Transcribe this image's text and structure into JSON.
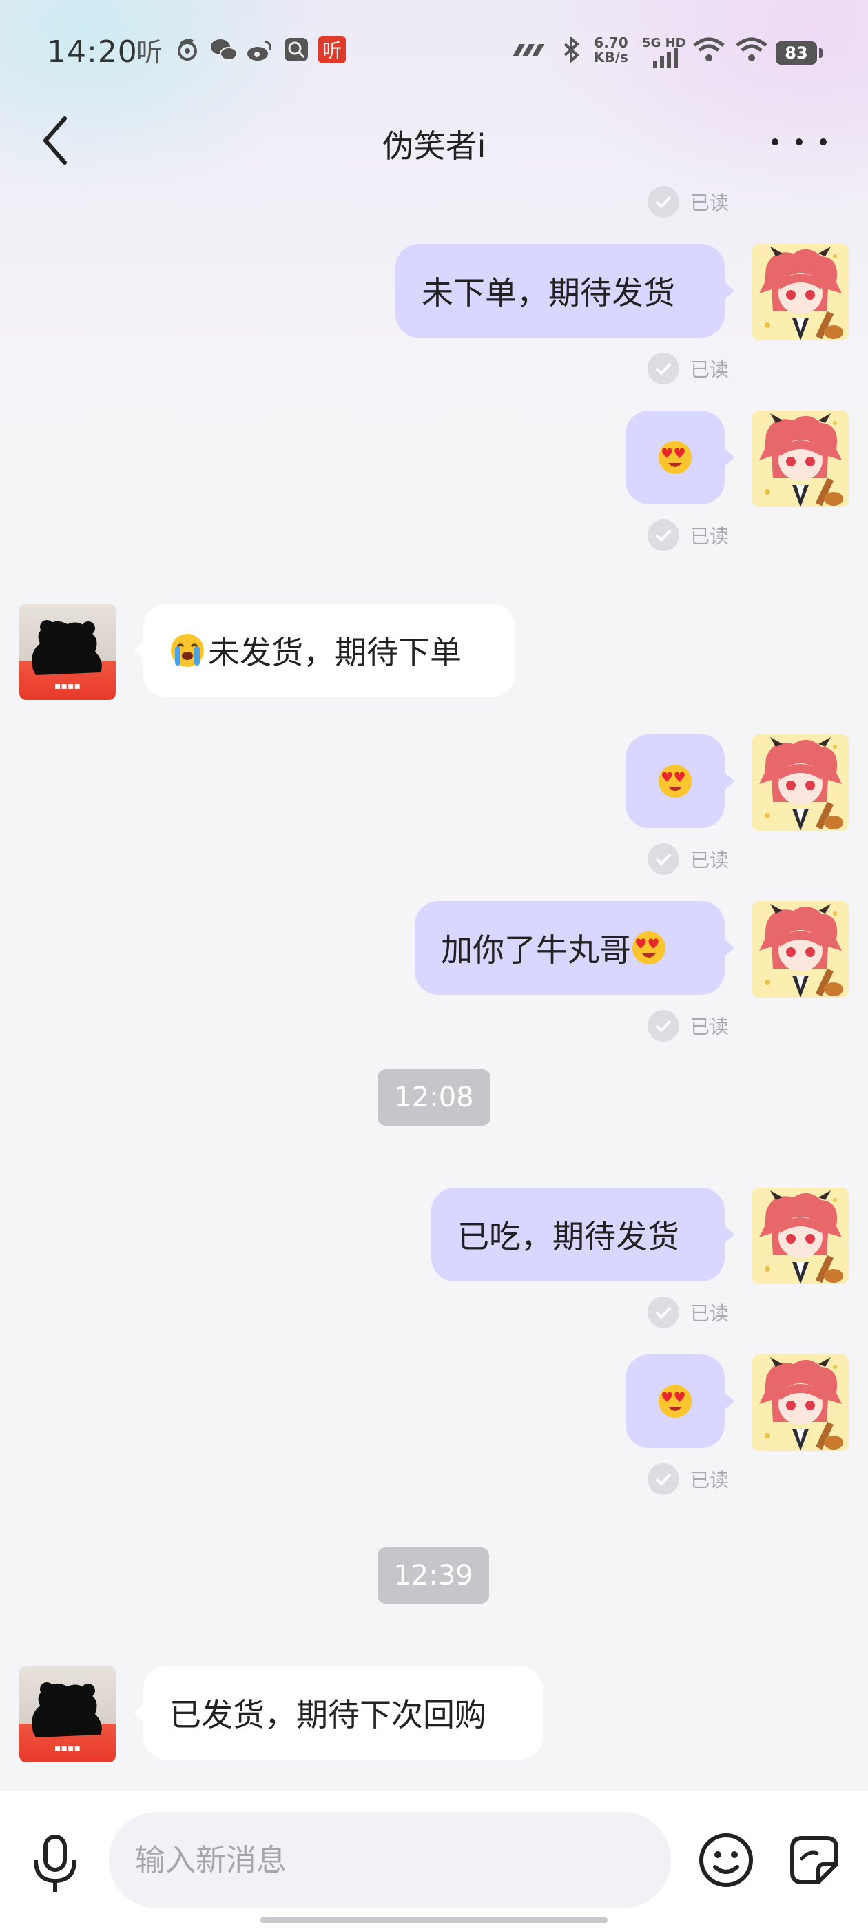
{
  "status_bar": {
    "time": "14:20",
    "ting_label": "听",
    "speed": "6.70",
    "speed_unit": "KB/s",
    "network": "5G HD",
    "battery": "83"
  },
  "header": {
    "title": "伪笑者i",
    "back_icon": "chevron-left-icon",
    "more_icon": "more-horizontal-icon"
  },
  "chat": {
    "read_label": "已读",
    "messages": [
      {
        "side": "out",
        "text": "未下单，期待发货",
        "emoji": ""
      },
      {
        "side": "out",
        "text": "",
        "emoji": "heart-eyes-emoji"
      },
      {
        "side": "in",
        "text": "未发货，期待下单",
        "emoji": "loudly-crying-emoji"
      },
      {
        "side": "out",
        "text": "",
        "emoji": "heart-eyes-emoji"
      },
      {
        "side": "out",
        "text": "加你了牛丸哥",
        "emoji": "heart-eyes-emoji"
      },
      {
        "side": "time",
        "text": "12:08"
      },
      {
        "side": "out",
        "text": "已吃，期待发货",
        "emoji": ""
      },
      {
        "side": "out",
        "text": "",
        "emoji": "heart-eyes-emoji"
      },
      {
        "side": "time",
        "text": "12:39"
      },
      {
        "side": "in",
        "text": "已发货，期待下次回购",
        "emoji": ""
      }
    ]
  },
  "input_bar": {
    "placeholder": "输入新消息",
    "voice_icon": "microphone-icon",
    "emoji_icon": "smiley-icon",
    "sticker_icon": "sticker-icon"
  },
  "colors": {
    "outgoing_bubble": "#d9d6ff",
    "incoming_bubble": "#ffffff",
    "background": "#f5f5f8",
    "time_divider": "#c6c6ca"
  }
}
